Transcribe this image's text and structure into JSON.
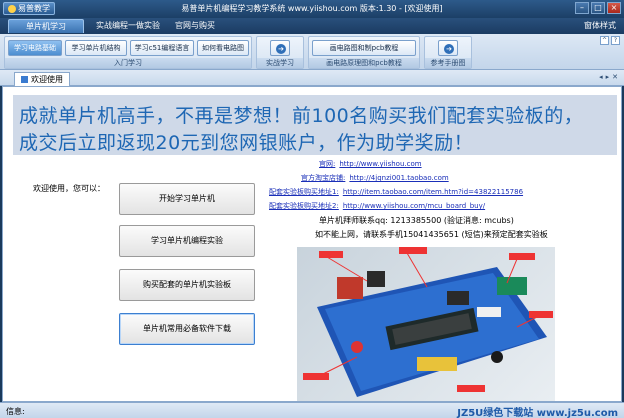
{
  "app": {
    "logo_label": "易普教学",
    "window_title": "易普单片机编程学习教学系统 www.yiishou.com 版本:1.30 - [欢迎使用]"
  },
  "menubar": {
    "tabs": [
      "单片机学习",
      "实战编程一做实验",
      "官网与购买"
    ],
    "right_label": "窗体样式"
  },
  "ribbon": {
    "group1": {
      "buttons": [
        "学习电路基础",
        "学习单片机结构",
        "学习c51编程语言",
        "如何看电路图"
      ],
      "caption": "入门学习"
    },
    "group2_caption": "实战学习",
    "group3": {
      "buttons": [
        "画电路图和制pcb教程"
      ],
      "caption": "画电路原理图和pcb教程"
    },
    "group4_caption": "参考手册图"
  },
  "doc_tab": {
    "label": "欢迎使用"
  },
  "banner": {
    "line1": "成就单片机高手，不再是梦想！前100名购买我们配套实验板的，",
    "line2": "成交后立即返现20元到您网银账户，作为助学奖励！"
  },
  "welcome": {
    "greeting": "欢迎使用，您可以：",
    "buttons": [
      "开始学习单片机",
      "学习单片机编程实验",
      "购买配套的单片机实验板",
      "单片机常用必备软件下载"
    ]
  },
  "links": [
    {
      "label": "官网:",
      "url": "http://www.yiishou.com"
    },
    {
      "label": "官方淘宝店铺:",
      "url": "http://4jqnzi001.taobao.com"
    },
    {
      "label": "配套实验板购买地址1:",
      "url": "http://item.taobao.com/item.htm?id=43822115786"
    },
    {
      "label": "配套实验板购买地址2:",
      "url": "http://www.yiishou.com/mcu_board_buy/"
    }
  ],
  "contact": {
    "qq_line": "单片机拜师联系qq: 1213385500 (验证消息: mcubs)",
    "phone_line": "如不能上网，请联系手机15041435651 (短信)来预定配套实验板"
  },
  "status": {
    "label": "信息:",
    "watermark": "JZ5U绿色下载站 www.jz5u.com"
  }
}
